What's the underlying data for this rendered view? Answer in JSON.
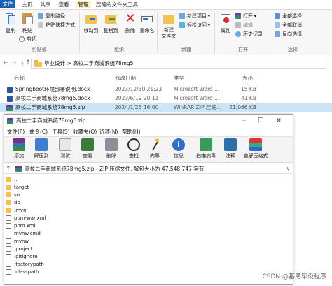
{
  "ribbon_tabs": [
    "文件",
    "主页",
    "共享",
    "查看",
    "管理",
    "压缩的文件夹工具"
  ],
  "ribbon": {
    "clipboard": {
      "copy": "复制",
      "paste": "粘贴",
      "copy_path": "复制路径",
      "paste_shortcut": "粘贴快捷方式",
      "cut": "剪切",
      "label": "剪贴板"
    },
    "organize": {
      "move_to": "移动到",
      "copy_to": "复制到",
      "delete": "删除",
      "rename": "重命名",
      "label": "组织"
    },
    "new": {
      "new_folder": "新建\n文件夹",
      "new_item": "新建项目",
      "easy_access": "轻松访问",
      "label": "新建"
    },
    "open": {
      "properties": "属性",
      "open": "打开",
      "edit": "编辑",
      "history": "历史记录",
      "label": "打开"
    },
    "select": {
      "select_all": "全部选择",
      "select_none": "全部取消",
      "invert": "反向选择",
      "label": "选择"
    }
  },
  "address": {
    "path": "毕业设计 > 高校二手商城系统78mg5"
  },
  "file_list": {
    "headers": [
      "名称",
      "修改日期",
      "类型",
      "大小"
    ],
    "rows": [
      {
        "name": "Springboot环境部署说明.docx",
        "date": "2023/12/30 21:23",
        "type": "Microsoft Word ...",
        "size": "15 KB",
        "icon": "docx-icon"
      },
      {
        "name": "高校二手商城系统78mg5.docx",
        "date": "2023/6/19 20:11",
        "type": "Microsoft Word ...",
        "size": "41 KB",
        "icon": "docx-icon"
      },
      {
        "name": "高校二手商城系统78mg5.zip",
        "date": "2024/1/25 16:00",
        "type": "WinRAR ZIP 压缩...",
        "size": "21,066 KB",
        "icon": "zip-icon"
      }
    ]
  },
  "rar": {
    "title": "高校二手商城系统78mg5.zip",
    "menu": [
      "文件(F)",
      "命令(C)",
      "工具(S)",
      "收藏夹(O)",
      "选项(N)",
      "帮助(H)"
    ],
    "toolbar": [
      "添加",
      "解压到",
      "测试",
      "查看",
      "删除",
      "查找",
      "向导",
      "信息",
      "扫描病毒",
      "注释",
      "自解压格式"
    ],
    "path": "高校二手商城系统78mg5.zip - ZIP 压缩文件, 解包大小为 47,548,747 字节",
    "entries": [
      {
        "name": "..",
        "kind": "up"
      },
      {
        "name": "target",
        "kind": "folder"
      },
      {
        "name": "src",
        "kind": "folder"
      },
      {
        "name": "db",
        "kind": "folder"
      },
      {
        "name": ".mvn",
        "kind": "folder"
      },
      {
        "name": "pom-war.xml",
        "kind": "file"
      },
      {
        "name": "pom.xml",
        "kind": "file"
      },
      {
        "name": "mvnw.cmd",
        "kind": "file"
      },
      {
        "name": "mvnw",
        "kind": "file"
      },
      {
        "name": ".project",
        "kind": "file"
      },
      {
        "name": ".gitignore",
        "kind": "file"
      },
      {
        "name": ".factorypath",
        "kind": "file"
      },
      {
        "name": ".classpath",
        "kind": "file"
      }
    ]
  },
  "watermark": "CSDN @基务毕设程序"
}
